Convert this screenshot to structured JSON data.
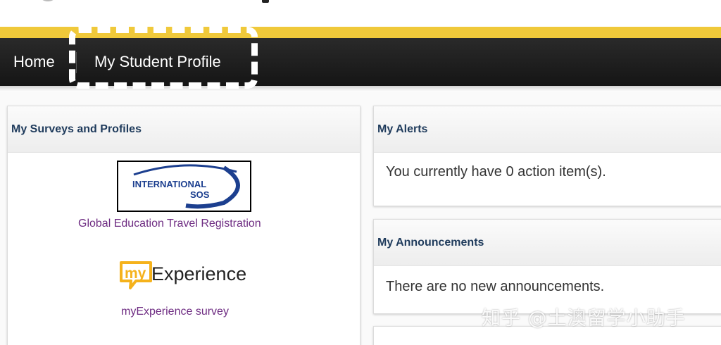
{
  "nav": {
    "home_label": "Home",
    "profile_label": "My Student Profile"
  },
  "surveys_panel": {
    "title": "My Surveys and Profiles",
    "sos_logo_text": [
      "INTERNATIONAL",
      "SOS"
    ],
    "global_link": "Global Education Travel Registration",
    "myexp_logo_text": [
      "my",
      "Experience"
    ],
    "myexp_link": "myExperience survey"
  },
  "alerts_panel": {
    "title": "My Alerts",
    "message": "You currently have 0 action item(s)."
  },
  "announcements_panel": {
    "title": "My Announcements",
    "message": "There are no new announcements."
  },
  "watermark": {
    "text": "知乎 @土澳留学小助手"
  },
  "colors": {
    "gold": "#f0c93a",
    "navbar": "#1c1c1c",
    "panel_title": "#1f3b5c",
    "link": "#6e2c82",
    "sos_blue": "#1c3f8f",
    "myexp_yellow": "#f5b21c"
  }
}
